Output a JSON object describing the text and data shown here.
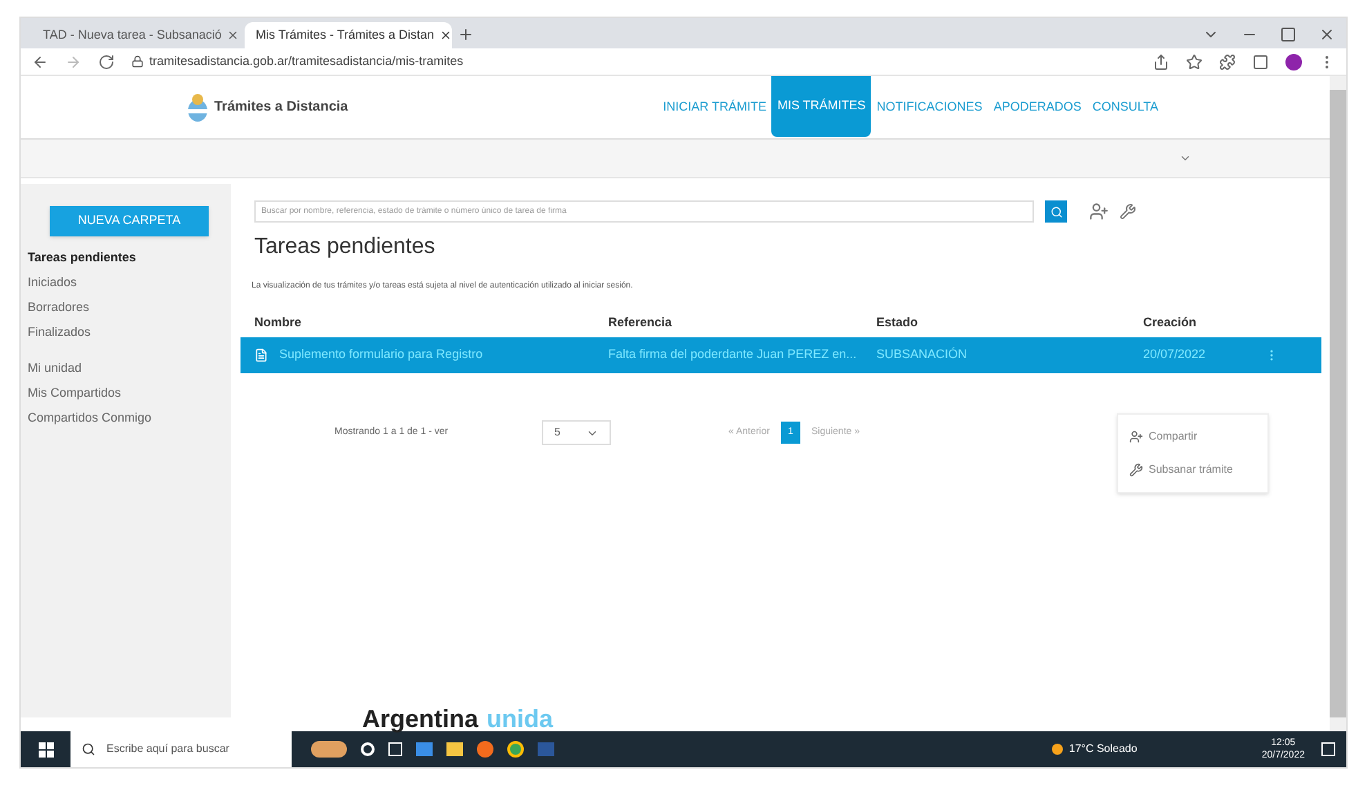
{
  "browser": {
    "tabs": [
      {
        "title": "TAD - Nueva tarea - Subsanació",
        "selected": false
      },
      {
        "title": "Mis Trámites - Trámites a Distan",
        "selected": true
      }
    ],
    "url": "tramitesadistancia.gob.ar/tramitesadistancia/mis-tramites"
  },
  "header": {
    "brand": "Trámites a Distancia",
    "nav": [
      {
        "label": "INICIAR TRÁMITE",
        "selected": false
      },
      {
        "label": "MIS TRÁMITES",
        "selected": true
      },
      {
        "label": "NOTIFICACIONES",
        "selected": false
      },
      {
        "label": "APODERADOS",
        "selected": false
      },
      {
        "label": "CONSULTA",
        "selected": false
      }
    ]
  },
  "sidebar": {
    "new_button": "NUEVA CARPETA",
    "sections": [
      {
        "items": [
          {
            "label": "Tareas pendientes",
            "selected": true
          },
          {
            "label": "Iniciados",
            "selected": false
          },
          {
            "label": "Borradores",
            "selected": false
          },
          {
            "label": "Finalizados",
            "selected": false
          }
        ]
      },
      {
        "items": [
          {
            "label": "Mi unidad",
            "selected": false
          },
          {
            "label": "Mis Compartidos",
            "selected": false
          },
          {
            "label": "Compartidos Conmigo",
            "selected": false
          }
        ]
      }
    ]
  },
  "search": {
    "placeholder": "Buscar por nombre, referencia, estado de trámite o número único de tarea de firma"
  },
  "title": "Tareas pendientes",
  "note": "La visualización de tus trámites y/o tareas está sujeta al nivel de autenticación utilizado al iniciar sesión.",
  "table": {
    "columns": [
      "Nombre",
      "Referencia",
      "Estado",
      "Creación"
    ],
    "rows": [
      {
        "selected": true,
        "cells": [
          "Suplemento formulario para Registro",
          "Falta firma del poderdante Juan PEREZ en...",
          "SUBSANACIÓN",
          "20/07/2022"
        ]
      }
    ]
  },
  "row_menu": {
    "items": [
      "Compartir",
      "Subsanar trámite"
    ]
  },
  "pagination": {
    "summary": "Mostrando 1 a 1 de 1 - ver",
    "page_size": "5",
    "prev": "« Anterior",
    "pages": [
      {
        "label": "1",
        "selected": true
      }
    ],
    "next": "Siguiente »"
  },
  "footer": {
    "parts": [
      "Argentina",
      "unida"
    ]
  },
  "taskbar": {
    "search_placeholder": "Escribe aquí para buscar",
    "weather": "17°C Soleado",
    "time": "12:05",
    "date": "20/7/2022"
  }
}
